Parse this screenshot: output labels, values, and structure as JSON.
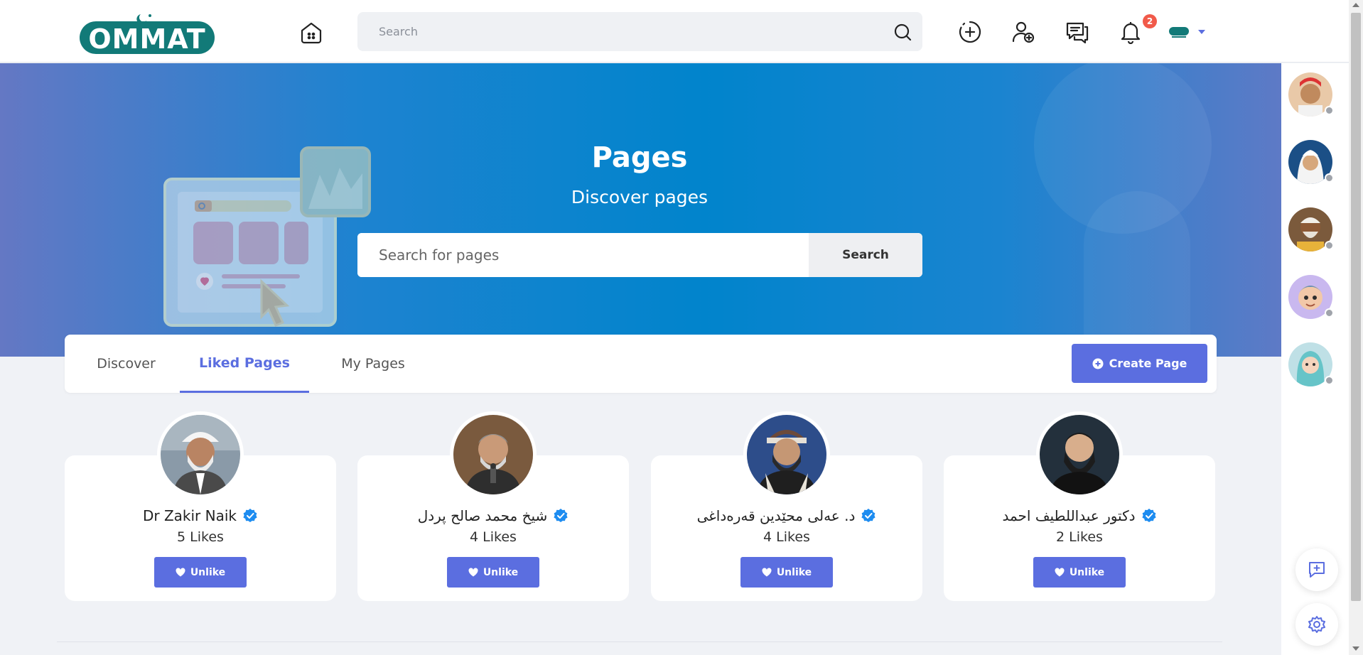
{
  "header": {
    "logo_text": "OMMAT",
    "search_placeholder": "Search",
    "notifications_count": "2"
  },
  "hero": {
    "title": "Pages",
    "subtitle": "Discover pages",
    "search_placeholder": "Search for pages",
    "search_button": "Search"
  },
  "tabs": [
    {
      "label": "Discover",
      "active": false
    },
    {
      "label": "Liked Pages",
      "active": true
    },
    {
      "label": "My Pages",
      "active": false
    }
  ],
  "create_button": "Create Page",
  "pages": [
    {
      "name": "Dr Zakir Naik",
      "likes": "5 Likes",
      "button": "Unlike"
    },
    {
      "name": "شیخ محمد صالح پردل",
      "likes": "4 Likes",
      "button": "Unlike"
    },
    {
      "name": "د. عەلی محێدین قەرەداغی",
      "likes": "4 Likes",
      "button": "Unlike"
    },
    {
      "name": "دکتور عبداللطیف احمد",
      "likes": "2 Likes",
      "button": "Unlike"
    }
  ],
  "colors": {
    "accent": "#5b6ee0",
    "hero_blue": "#0184cc",
    "badge_red": "#f15a4a",
    "verified_blue": "#1d8cf0",
    "logo_teal": "#127a78"
  }
}
